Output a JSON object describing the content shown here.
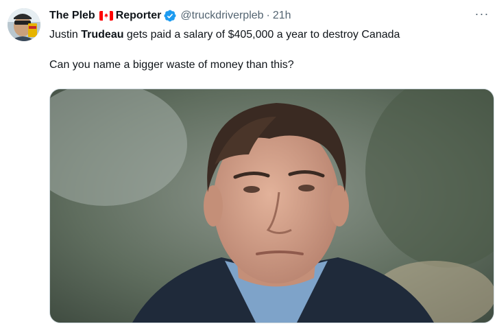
{
  "tweet": {
    "author_name": "The Pleb",
    "flag_icon": "canada-flag-icon",
    "author_name_suffix": "Reporter",
    "verified_icon": "verified-badge-icon",
    "handle": "@truckdriverpleb",
    "separator": "·",
    "time": "21h",
    "more_label": "···",
    "text_line1_pre": "Justin ",
    "text_line1_bold": "Trudeau",
    "text_line1_post": " gets paid a salary of $405,000 a year to destroy Canada",
    "text_line2": "Can you name a bigger waste of money than this?",
    "colors": {
      "text": "#0f1419",
      "secondary": "#536471",
      "verified": "#1d9bf0",
      "flag_red": "#ff0000"
    }
  }
}
